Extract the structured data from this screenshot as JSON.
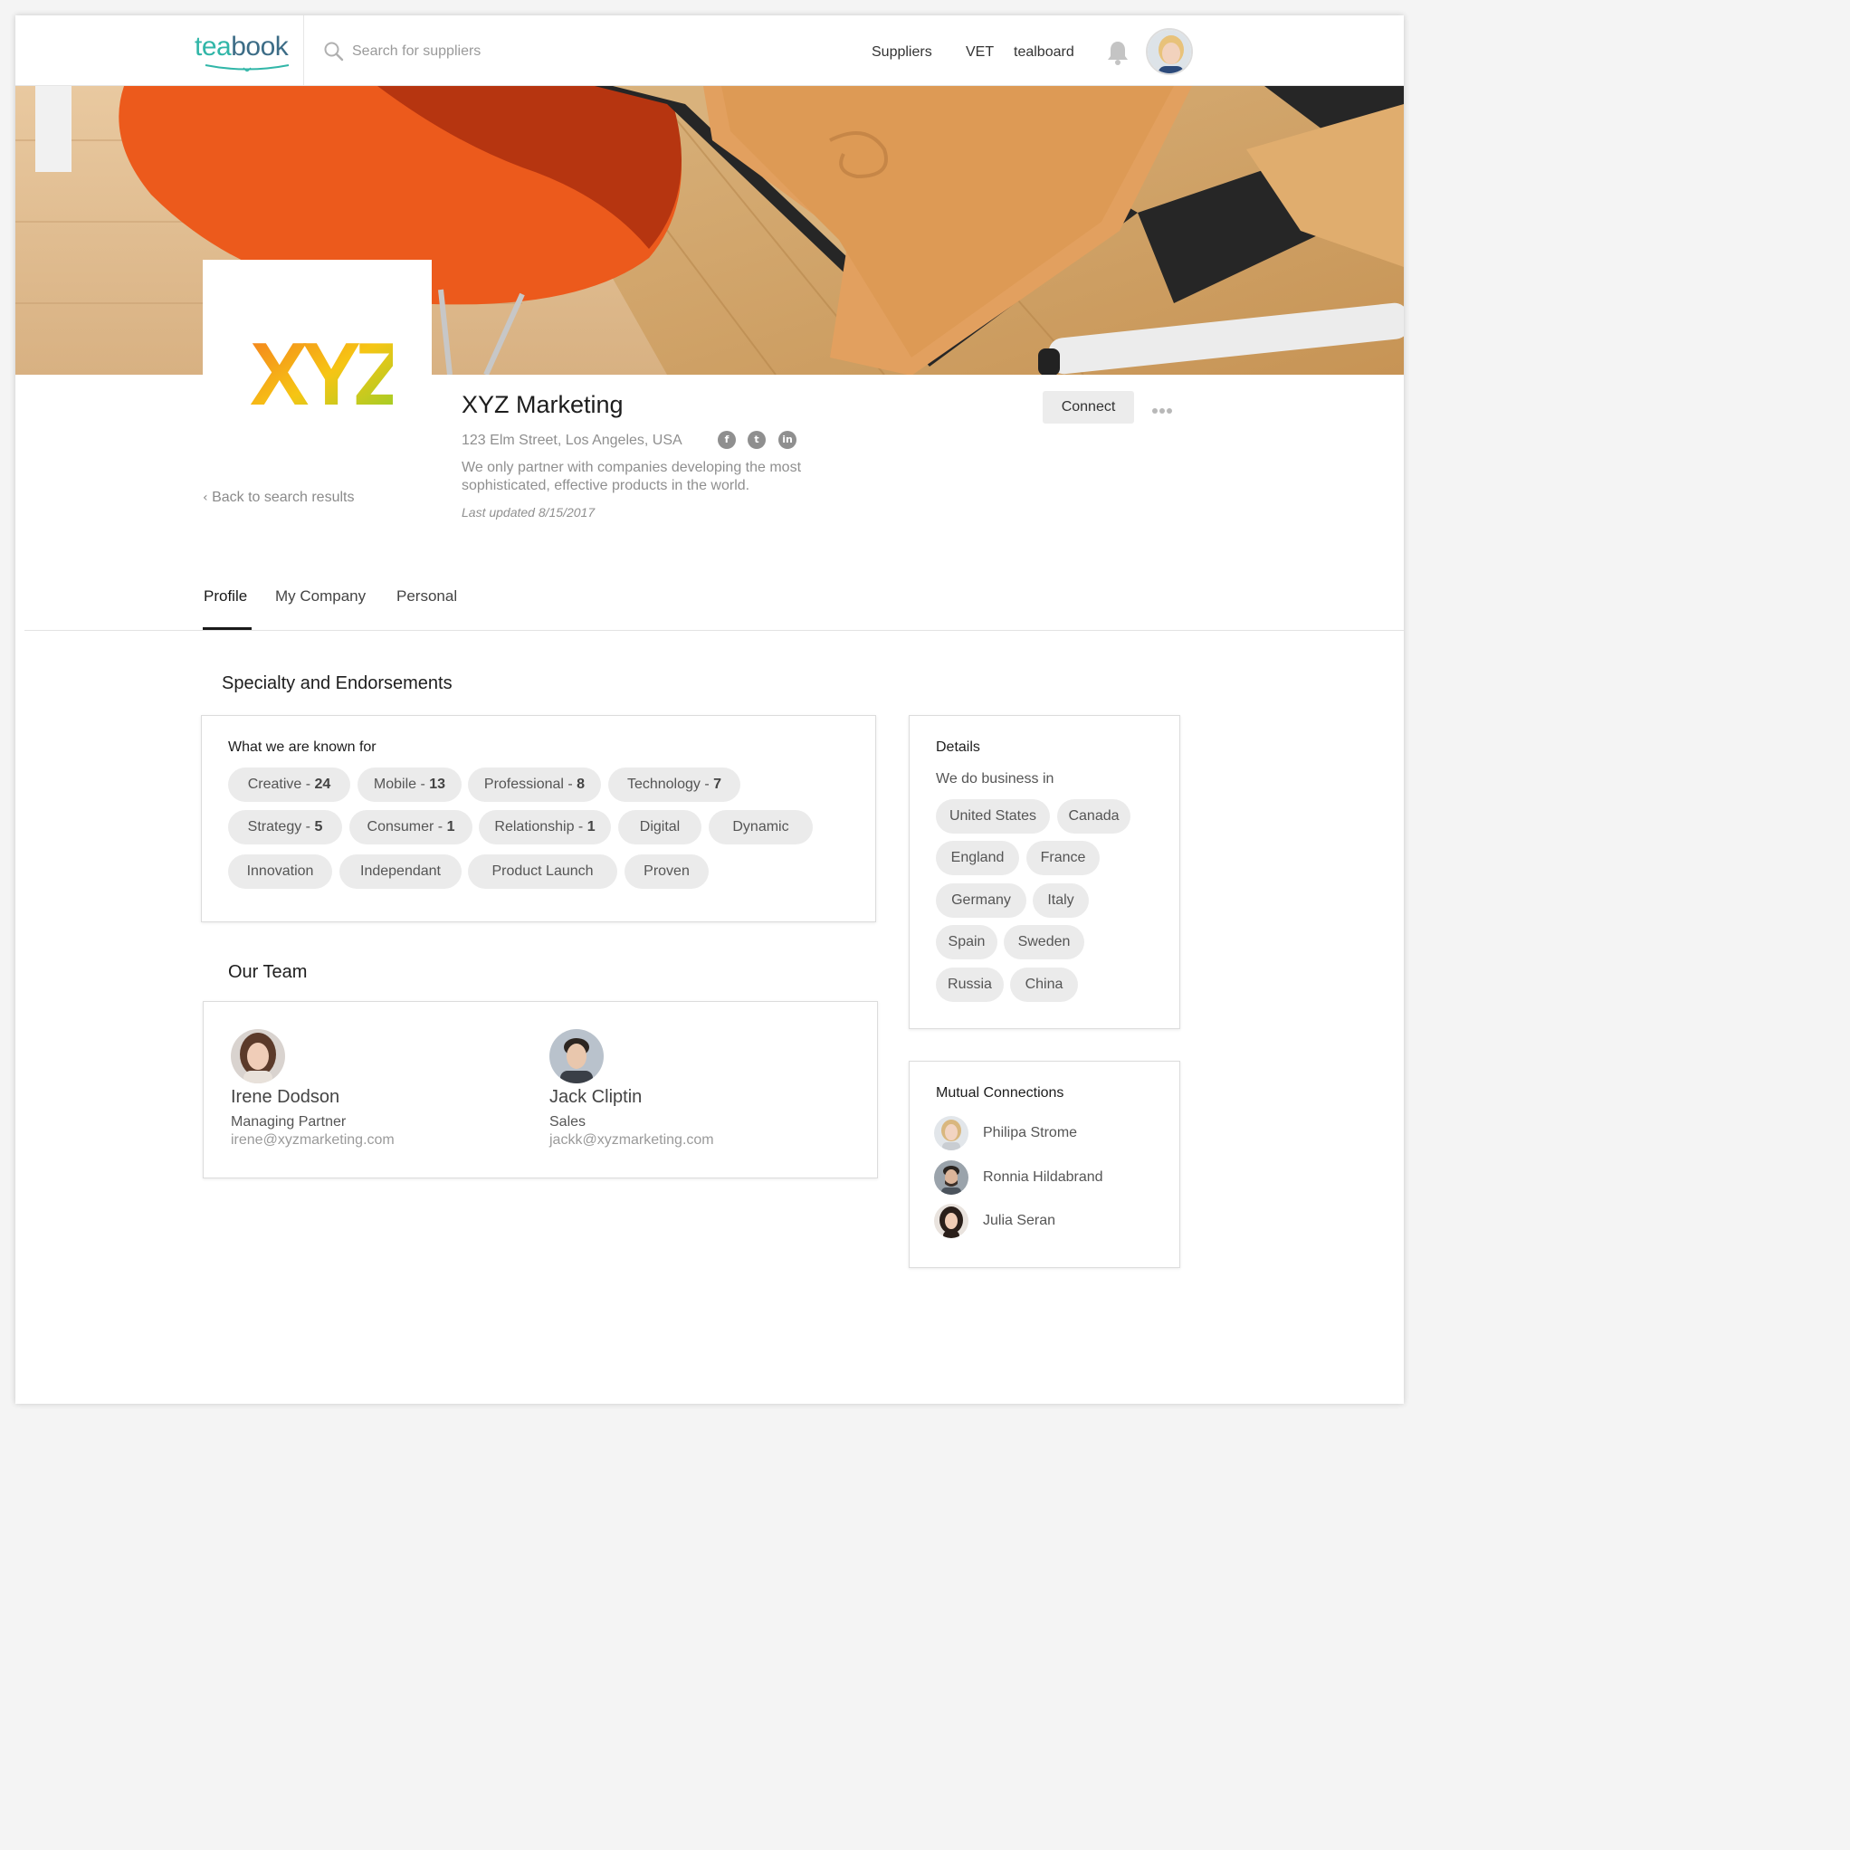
{
  "app": {
    "logo_part1": "tea",
    "logo_part2": "book",
    "brand_teal": "#31b6a8",
    "brand_navy": "#3c6c86"
  },
  "nav": {
    "search_placeholder": "Search for suppliers",
    "links": [
      "Suppliers",
      "VET",
      "tealboard"
    ],
    "icons": [
      "search-icon",
      "bell-icon",
      "user-avatar"
    ]
  },
  "company": {
    "logo_text": "XYZ",
    "name": "XYZ Marketing",
    "address": "123 Elm Street, Los Angeles, USA",
    "social": [
      "facebook-icon",
      "twitter-icon",
      "linkedin-icon"
    ],
    "description": "We only partner with companies developing the most sophisticated, effective products in the world.",
    "last_updated": "Last updated 8/15/2017",
    "connect_label": "Connect",
    "back_label": "Back to search results"
  },
  "tabs": [
    {
      "label": "Profile",
      "active": true
    },
    {
      "label": "My Company",
      "active": false
    },
    {
      "label": "Personal",
      "active": false
    }
  ],
  "specialty": {
    "section_title": "Specialty and Endorsements",
    "card_title": "What we are known for",
    "tags": [
      {
        "label": "Creative - ",
        "count": "24"
      },
      {
        "label": "Mobile - ",
        "count": "13"
      },
      {
        "label": "Professional - ",
        "count": "8"
      },
      {
        "label": "Technology - ",
        "count": "7"
      },
      {
        "label": "Strategy - ",
        "count": "5"
      },
      {
        "label": "Consumer - ",
        "count": "1"
      },
      {
        "label": "Relationship - ",
        "count": "1"
      },
      {
        "label": "Digital",
        "count": ""
      },
      {
        "label": "Dynamic",
        "count": ""
      },
      {
        "label": "Innovation",
        "count": ""
      },
      {
        "label": "Independant",
        "count": ""
      },
      {
        "label": "Product Launch",
        "count": ""
      },
      {
        "label": "Proven",
        "count": ""
      }
    ]
  },
  "team": {
    "section_title": "Our Team",
    "members": [
      {
        "name": "Irene Dodson",
        "role": "Managing Partner",
        "email": "irene@xyzmarketing.com"
      },
      {
        "name": "Jack Cliptin",
        "role": "Sales",
        "email": "jackk@xyzmarketing.com"
      }
    ]
  },
  "details": {
    "title": "Details",
    "subtitle": "We do business in",
    "countries": [
      "United States",
      "Canada",
      "England",
      "France",
      "Germany",
      "Italy",
      "Spain",
      "Sweden",
      "Russia",
      "China"
    ]
  },
  "mutual": {
    "title": "Mutual Connections",
    "people": [
      "Philipa Strome",
      "Ronnia Hildabrand",
      "Julia Seran"
    ]
  }
}
